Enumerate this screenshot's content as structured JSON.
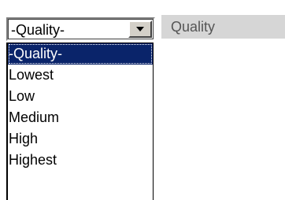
{
  "quality_select": {
    "value": "-Quality-",
    "options": [
      "-Quality-",
      "Lowest",
      "Low",
      "Medium",
      "High",
      "Highest"
    ],
    "highlighted_index": 0
  },
  "quality_label": {
    "text": "Quality"
  },
  "icons": {
    "dropdown_arrow": "chevron-down-icon"
  },
  "colors": {
    "highlight": "#0a246a",
    "label_background": "#d6d6d6",
    "button_face": "#d4d0c8"
  }
}
